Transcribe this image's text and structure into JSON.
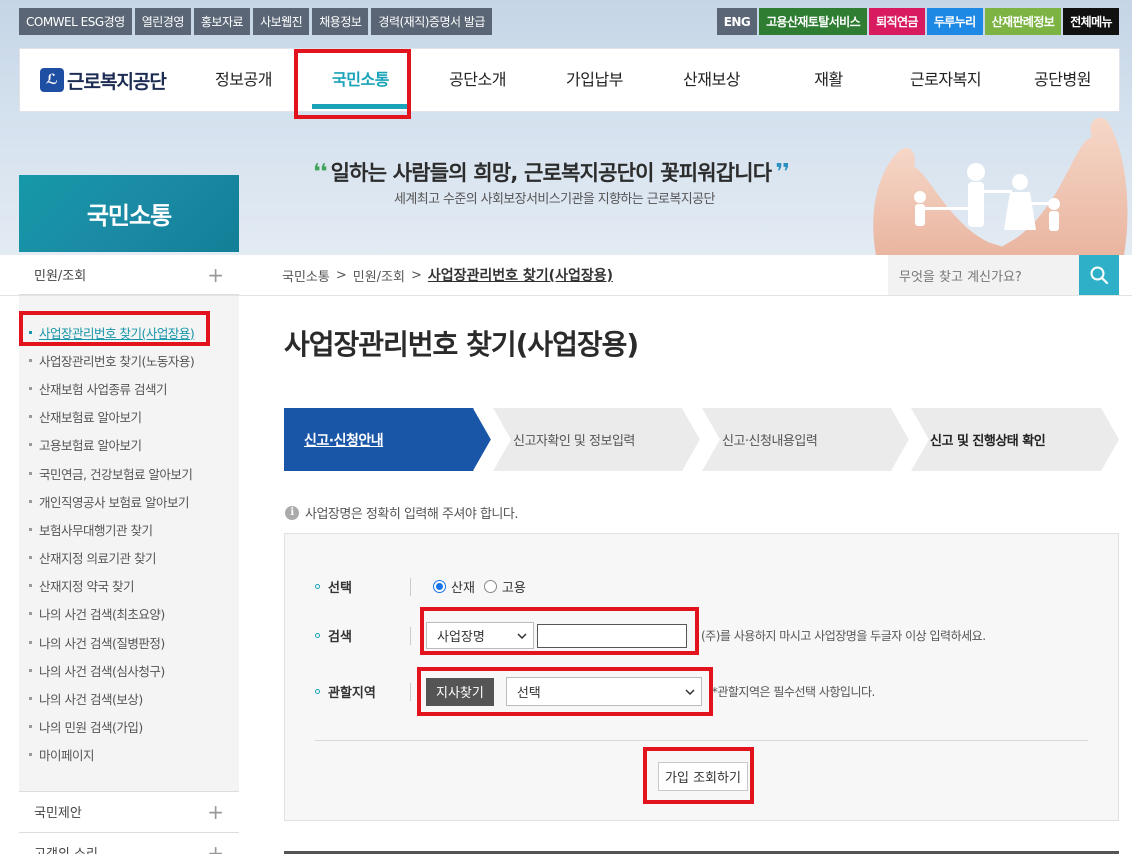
{
  "utility": {
    "left": [
      "COMWEL ESG경영",
      "열린경영",
      "홍보자료",
      "사보웹진",
      "채용정보",
      "경력(재직)증명서 발급"
    ],
    "right": [
      {
        "label": "ENG",
        "color": "#5a6675"
      },
      {
        "label": "고용산재토탈서비스",
        "color": "#2e7d32"
      },
      {
        "label": "퇴직연금",
        "color": "#d81b60"
      },
      {
        "label": "두루누리",
        "color": "#1e88e5"
      },
      {
        "label": "산재판례정보",
        "color": "#7cb342"
      },
      {
        "label": "전체메뉴",
        "color": "#111111"
      }
    ]
  },
  "logo": {
    "mark": "ℒ",
    "text": "근로복지공단"
  },
  "nav": [
    "정보공개",
    "국민소통",
    "공단소개",
    "가입납부",
    "산재보상",
    "재활",
    "근로자복지",
    "공단병원"
  ],
  "hero": {
    "title": "일하는 사람들의 희망, 근로복지공단이 꽃피워갑니다",
    "subtitle": "세계최고 수준의 사회보장서비스기관을 지향하는 근로복지공단"
  },
  "side_title": "국민소통",
  "side_head": "민원/조회",
  "breadcrumb": {
    "home": "국민소통",
    "sep": ">",
    "level2": "민원/조회",
    "current": "사업장관리번호 찾기(사업장용)"
  },
  "search": {
    "placeholder": "무엇을 찾고 계신가요?"
  },
  "sidebar": {
    "items": [
      "사업장관리번호 찾기(사업장용)",
      "사업장관리번호 찾기(노동자용)",
      "산재보험 사업종류 검색기",
      "산재보험료 알아보기",
      "고용보험료 알아보기",
      "국민연금, 건강보험료 알아보기",
      "개인직영공사 보험료 알아보기",
      "보험사무대행기관 찾기",
      "산재지정 의료기관 찾기",
      "산재지정 약국 찾기",
      "나의 사건 검색(최초요양)",
      "나의 사건 검색(질병판정)",
      "나의 사건 검색(심사청구)",
      "나의 사건 검색(보상)",
      "나의 민원 검색(가입)",
      "마이페이지"
    ],
    "sections": [
      "국민제안",
      "고객의 소리"
    ]
  },
  "page_title": "사업장관리번호 찾기(사업장용)",
  "steps": [
    "신고·신청안내",
    "신고자확인 및 정보입력",
    "신고·신청내용입력",
    "신고 및 진행상태 확인"
  ],
  "notice": "사업장명은 정확히 입력해 주셔야 합니다.",
  "form": {
    "select_label": "선택",
    "radio_options": [
      "산재",
      "고용"
    ],
    "search_label": "검색",
    "search_type": "사업장명",
    "search_value": "",
    "search_hint": "(주)를 사용하지 마시고 사업장명을 두글자 이상 입력하세요.",
    "region_label": "관할지역",
    "branch_button": "지사찾기",
    "region_value": "선택",
    "region_hint": "*관할지역은 필수선택 사항입니다.",
    "submit": "가입 조회하기"
  },
  "colors": {
    "accent": "#1aa3b8",
    "step_active": "#1a56a8",
    "highlight": "#e3131e"
  }
}
